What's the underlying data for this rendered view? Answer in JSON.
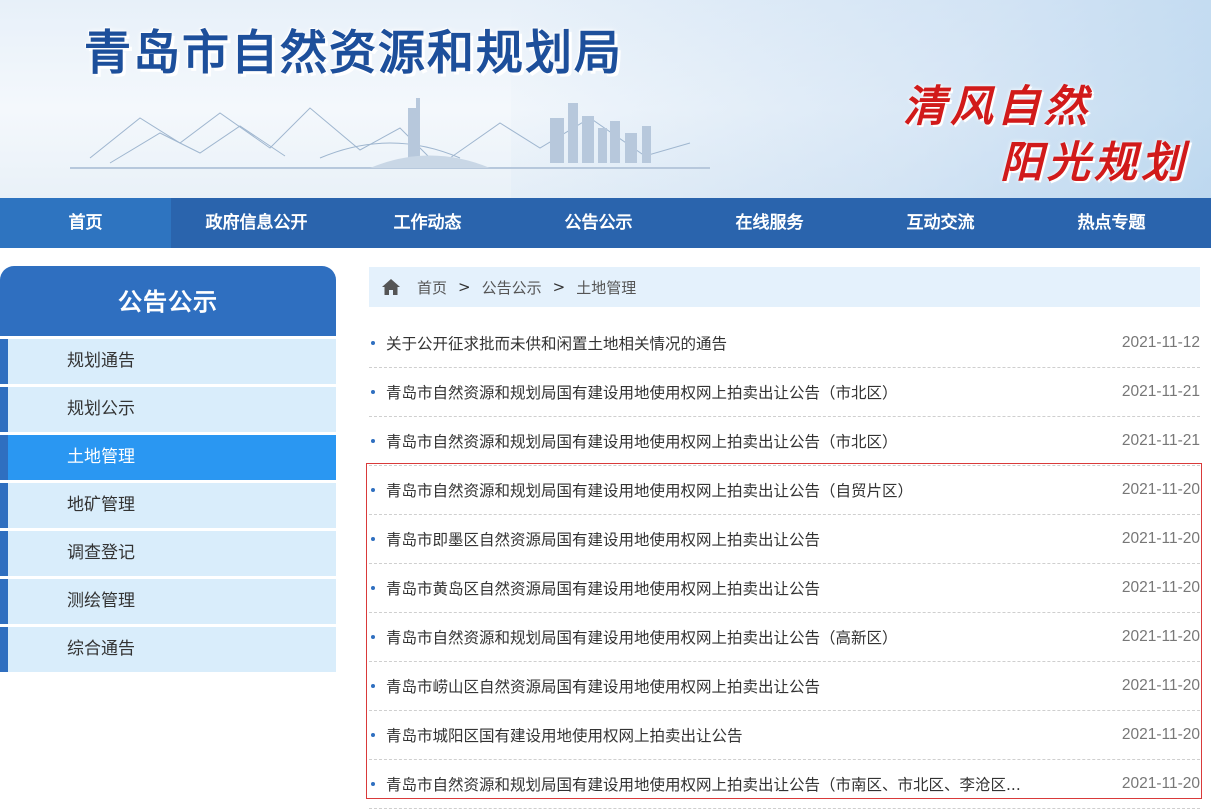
{
  "header": {
    "site_title": "青岛市自然资源和规划局",
    "slogan_line1": "清风自然",
    "slogan_line2": "阳光规划"
  },
  "nav": {
    "items": [
      "首页",
      "政府信息公开",
      "工作动态",
      "公告公示",
      "在线服务",
      "互动交流",
      "热点专题"
    ],
    "active_index": 0
  },
  "sidebar": {
    "title": "公告公示",
    "items": [
      "规划通告",
      "规划公示",
      "土地管理",
      "地矿管理",
      "调查登记",
      "测绘管理",
      "综合通告"
    ],
    "active_index": 2
  },
  "breadcrumb": {
    "icon": "home-icon",
    "items": [
      "首页",
      "公告公示",
      "土地管理"
    ],
    "separator": ">"
  },
  "news": [
    {
      "title": "关于公开征求批而未供和闲置土地相关情况的通告",
      "date": "2021-11-12"
    },
    {
      "title": "青岛市自然资源和规划局国有建设用地使用权网上拍卖出让公告（市北区）",
      "date": "2021-11-21"
    },
    {
      "title": "青岛市自然资源和规划局国有建设用地使用权网上拍卖出让公告（市北区）",
      "date": "2021-11-21"
    },
    {
      "title": "青岛市自然资源和规划局国有建设用地使用权网上拍卖出让公告（自贸片区）",
      "date": "2021-11-20"
    },
    {
      "title": "青岛市即墨区自然资源局国有建设用地使用权网上拍卖出让公告",
      "date": "2021-11-20"
    },
    {
      "title": "青岛市黄岛区自然资源局国有建设用地使用权网上拍卖出让公告",
      "date": "2021-11-20"
    },
    {
      "title": "青岛市自然资源和规划局国有建设用地使用权网上拍卖出让公告（高新区）",
      "date": "2021-11-20"
    },
    {
      "title": "青岛市崂山区自然资源局国有建设用地使用权网上拍卖出让公告",
      "date": "2021-11-20"
    },
    {
      "title": "青岛市城阳区国有建设用地使用权网上拍卖出让公告",
      "date": "2021-11-20"
    },
    {
      "title": "青岛市自然资源和规划局国有建设用地使用权网上拍卖出让公告（市南区、市北区、李沧区...",
      "date": "2021-11-20"
    }
  ],
  "colors": {
    "brand_blue": "#2a64ad",
    "sidebar_active": "#2a97f2",
    "highlight_border": "#d93a3a",
    "slogan_red": "#d11a1a"
  }
}
